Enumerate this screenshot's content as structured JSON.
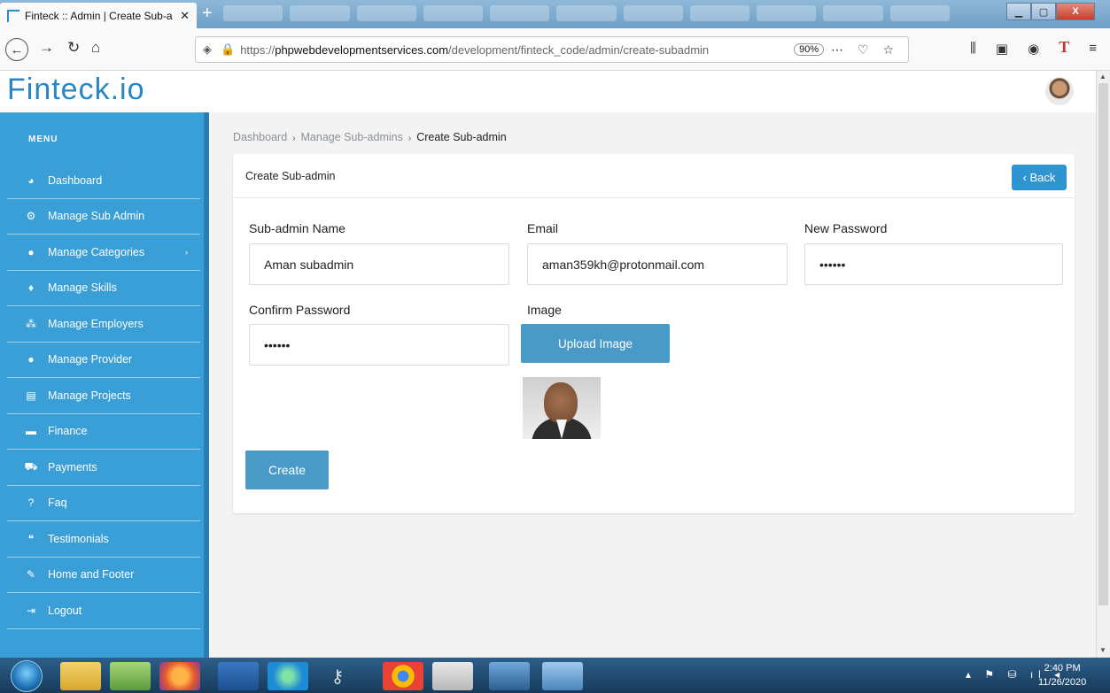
{
  "browser": {
    "tab_title": "Finteck :: Admin | Create Sub-a",
    "url_prefix": "https://",
    "url_domain": "phpwebdevelopmentservices.com",
    "url_path": "/development/finteck_code/admin/create-subadmin",
    "zoom": "90%"
  },
  "app": {
    "logo": "Finteck.io"
  },
  "sidebar": {
    "menu_label": "MENU",
    "items": [
      {
        "label": "Dashboard",
        "icon": "dashboard-icon"
      },
      {
        "label": "Manage Sub Admin",
        "icon": "gears-icon"
      },
      {
        "label": "Manage Categories",
        "icon": "user-icon"
      },
      {
        "label": "Manage Skills",
        "icon": "lightbulb-icon"
      },
      {
        "label": "Manage Employers",
        "icon": "users-icon"
      },
      {
        "label": "Manage Provider",
        "icon": "user-icon"
      },
      {
        "label": "Manage Projects",
        "icon": "list-icon"
      },
      {
        "label": "Finance",
        "icon": "credit-card-icon"
      },
      {
        "label": "Payments",
        "icon": "cart-icon"
      },
      {
        "label": "Faq",
        "icon": "question-icon"
      },
      {
        "label": "Testimonials",
        "icon": "quote-icon"
      },
      {
        "label": "Home and Footer",
        "icon": "pencil-icon"
      },
      {
        "label": "Logout",
        "icon": "sign-out-icon"
      }
    ]
  },
  "breadcrumb": {
    "items": [
      "Dashboard",
      "Manage Sub-admins",
      "Create Sub-admin"
    ]
  },
  "form": {
    "title": "Create Sub-admin",
    "back_label": "Back",
    "name_label": "Sub-admin Name",
    "name_value": "Aman subadmin",
    "email_label": "Email",
    "email_value": "aman359kh@protonmail.com",
    "password_label": "New Password",
    "password_value": "••••••",
    "confirm_label": "Confirm Password",
    "confirm_value": "••••••",
    "image_label": "Image",
    "upload_label": "Upload Image",
    "create_label": "Create"
  },
  "taskbar": {
    "time": "2:40 PM",
    "date": "11/26/2020"
  }
}
